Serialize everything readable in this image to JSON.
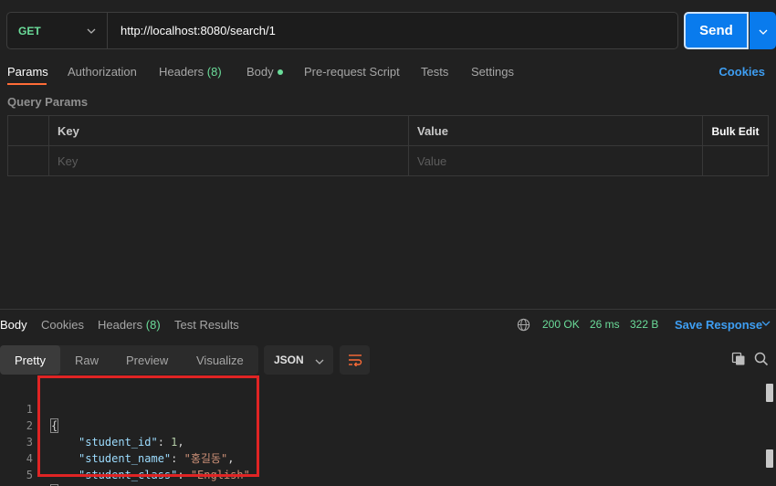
{
  "request": {
    "method": "GET",
    "url": "http://localhost:8080/search/1",
    "send_label": "Send"
  },
  "request_tabs": {
    "params": "Params",
    "authorization": "Authorization",
    "headers": "Headers",
    "headers_count": "(8)",
    "body": "Body",
    "prerequest": "Pre-request Script",
    "tests": "Tests",
    "settings": "Settings",
    "cookies": "Cookies"
  },
  "query_params": {
    "title": "Query Params",
    "columns": {
      "key": "Key",
      "value": "Value",
      "bulk_edit": "Bulk Edit"
    },
    "placeholders": {
      "key": "Key",
      "value": "Value"
    }
  },
  "response": {
    "tabs": {
      "body": "Body",
      "cookies": "Cookies",
      "headers": "Headers",
      "headers_count": "(8)",
      "test_results": "Test Results"
    },
    "status": "200 OK",
    "time": "26 ms",
    "size": "322 B",
    "save_label": "Save Response",
    "views": {
      "pretty": "Pretty",
      "raw": "Raw",
      "preview": "Preview",
      "visualize": "Visualize"
    },
    "format": "JSON",
    "code_lines": [
      {
        "num": "1",
        "open": "{"
      },
      {
        "num": "2",
        "key": "\"student_id\"",
        "sep": ": ",
        "value": "1",
        "trail": ","
      },
      {
        "num": "3",
        "key": "\"student_name\"",
        "sep": ": ",
        "value": "\"홍길동\"",
        "trail": ","
      },
      {
        "num": "4",
        "key": "\"student_class\"",
        "sep": ": ",
        "value": "\"English\"",
        "trail": ""
      },
      {
        "num": "5",
        "close": "}"
      }
    ]
  },
  "colors": {
    "accent": "#097bed",
    "success": "#6bdd9a",
    "link": "#3e9ef2",
    "tab_indicator": "#ff6c37",
    "highlight_box": "#e02424"
  }
}
